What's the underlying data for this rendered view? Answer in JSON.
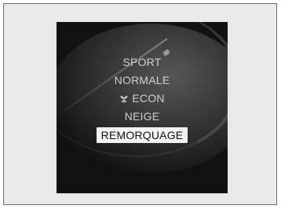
{
  "display": {
    "modes": [
      {
        "label": "SPORT",
        "state": "normal"
      },
      {
        "label": "NORMALE",
        "state": "normal"
      },
      {
        "label": "ECON",
        "state": "normal",
        "icon": "leaf-icon"
      },
      {
        "label": "NEIGE",
        "state": "normal"
      },
      {
        "label": "REMORQUAGE",
        "state": "selected"
      }
    ]
  },
  "colors": {
    "background": "#ffffff",
    "frame_fill": "#e9e9e9",
    "frame_border": "#6f6f6f",
    "display_bg": "#111111",
    "text_normal": "#d0d0d0",
    "selected_bg": "#f2f2f2",
    "selected_text": "#111111"
  }
}
